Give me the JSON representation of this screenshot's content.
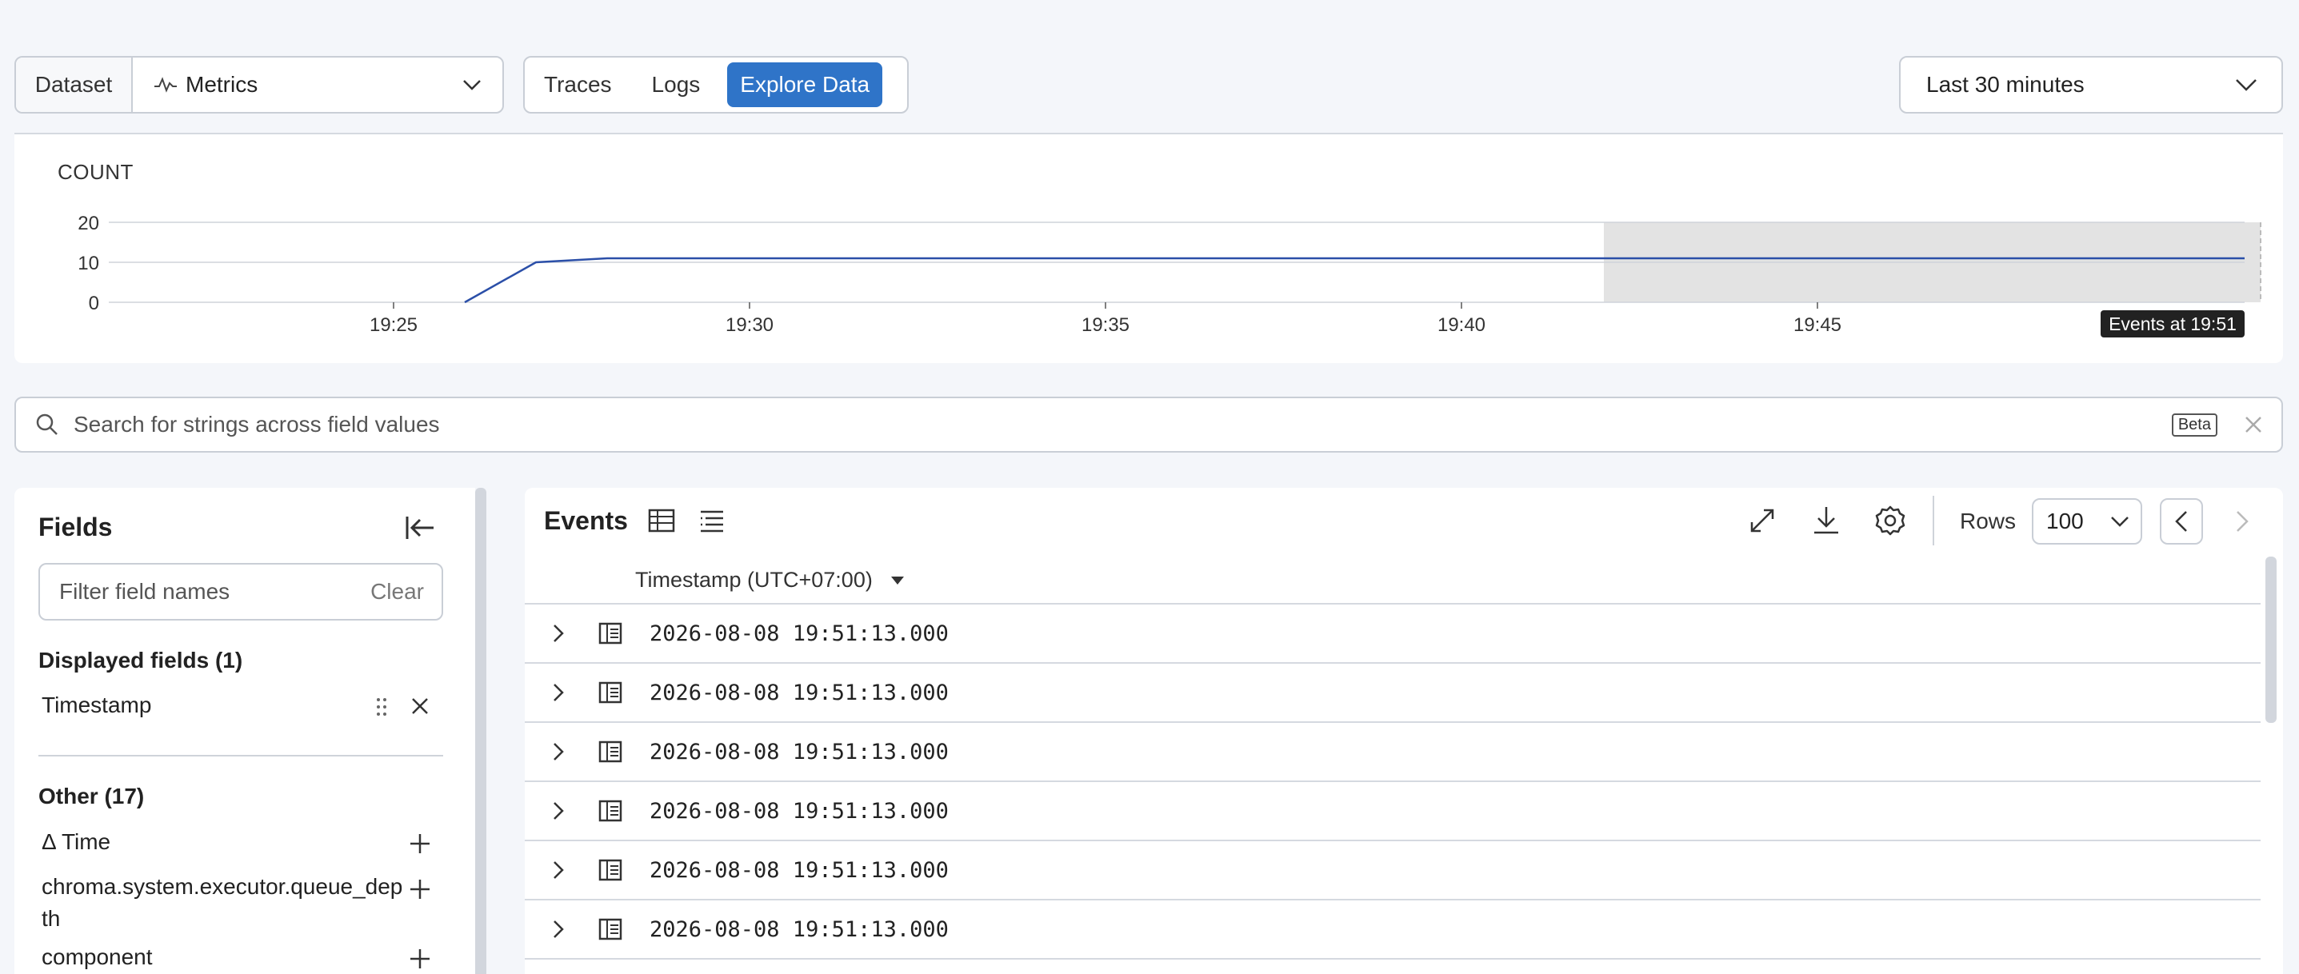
{
  "toolbar": {
    "dataset_label": "Dataset",
    "dataset_value": "Metrics",
    "tabs": [
      "Traces",
      "Logs",
      "Explore Data"
    ],
    "active_tab": "Explore Data",
    "time_range": "Last 30 minutes"
  },
  "chart": {
    "title": "COUNT",
    "tooltip": "Events at 19:51"
  },
  "chart_data": {
    "type": "line",
    "title": "COUNT",
    "xlabel": "",
    "ylabel": "",
    "x_ticks": [
      "19:25",
      "19:30",
      "19:35",
      "19:40",
      "19:45"
    ],
    "y_ticks": [
      0,
      10,
      20
    ],
    "ylim": [
      0,
      20
    ],
    "x_range": [
      "19:21",
      "19:51"
    ],
    "series": [
      {
        "x": [
          "19:26",
          "19:27",
          "19:28",
          "19:29",
          "19:30",
          "19:35",
          "19:40",
          "19:45",
          "19:50",
          "19:51"
        ],
        "values": [
          0,
          10,
          11,
          11,
          11,
          11,
          11,
          11,
          11,
          11
        ],
        "color": "#2b4fa8"
      }
    ],
    "highlight_range": [
      "19:42",
      "19:51"
    ],
    "grid": true
  },
  "search": {
    "placeholder": "Search for strings across field values",
    "badge": "Beta"
  },
  "fields": {
    "title": "Fields",
    "filter_placeholder": "Filter field names",
    "clear_label": "Clear",
    "displayed_header": "Displayed fields (1)",
    "displayed": [
      "Timestamp"
    ],
    "other_header": "Other (17)",
    "other": [
      "Δ Time",
      "chroma.system.executor.queue_dep",
      "th",
      "component"
    ]
  },
  "events": {
    "title": "Events",
    "rows_label": "Rows",
    "rows_value": "100",
    "column_header": "Timestamp (UTC+07:00)",
    "rows": [
      "2026-08-08 19:51:13.000",
      "2026-08-08 19:51:13.000",
      "2026-08-08 19:51:13.000",
      "2026-08-08 19:51:13.000",
      "2026-08-08 19:51:13.000",
      "2026-08-08 19:51:13.000"
    ]
  },
  "colors": {
    "accent": "#2f74c8",
    "line": "#2b4fa8"
  }
}
